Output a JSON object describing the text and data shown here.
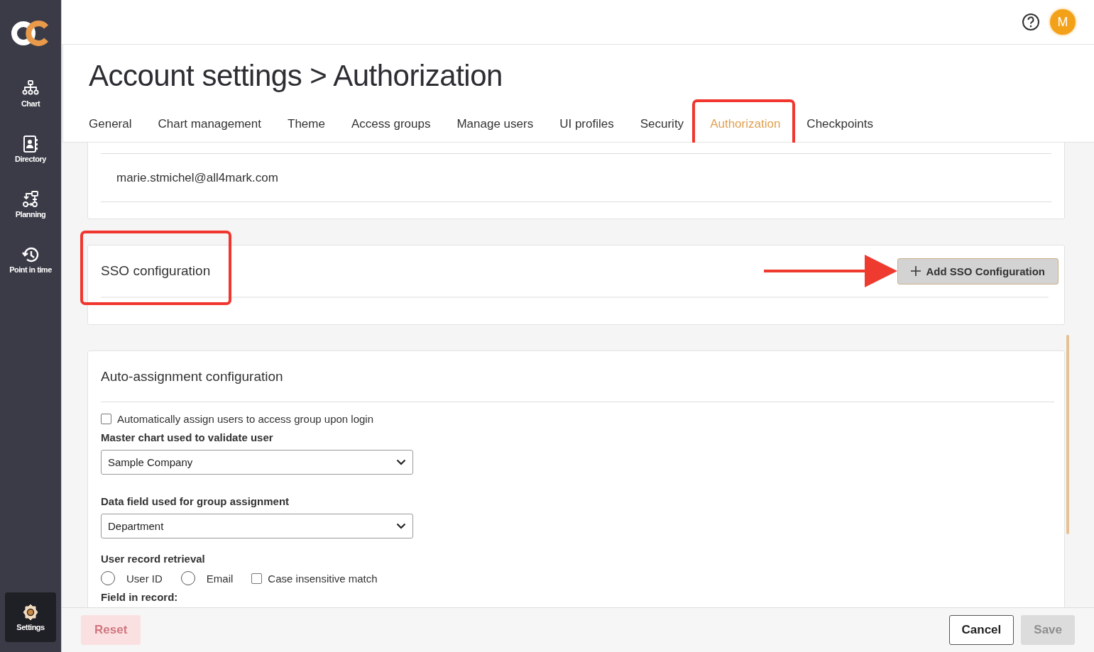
{
  "sidebar": {
    "items": [
      {
        "kind": "chart",
        "label": "Chart",
        "selected": false
      },
      {
        "kind": "directory",
        "label": "Directory",
        "selected": false
      },
      {
        "kind": "planning",
        "label": "Planning",
        "selected": false
      },
      {
        "kind": "history",
        "label": "Point in time",
        "selected": false
      }
    ],
    "bottom_item": {
      "kind": "settings",
      "label": "Settings",
      "selected": true
    }
  },
  "topbar": {
    "avatar": "M"
  },
  "page_title": "Account settings > Authorization",
  "tabs": [
    {
      "label": "General",
      "selected": false,
      "highlighted": false
    },
    {
      "label": "Chart management",
      "selected": false,
      "highlighted": false
    },
    {
      "label": "Theme",
      "selected": false,
      "highlighted": false
    },
    {
      "label": "Access groups",
      "selected": false,
      "highlighted": false
    },
    {
      "label": "Manage users",
      "selected": false,
      "highlighted": false
    },
    {
      "label": "UI profiles",
      "selected": false,
      "highlighted": false
    },
    {
      "label": "Security",
      "selected": false,
      "highlighted": false
    },
    {
      "label": "Authorization",
      "selected": true,
      "highlighted": true
    },
    {
      "label": "Checkpoints",
      "selected": false,
      "highlighted": false
    }
  ],
  "sections": [
    {
      "kind": "user_list",
      "rows": [
        "marie.stmichel@all4mark.com"
      ]
    },
    {
      "kind": "sso",
      "title": "SSO configuration",
      "highlighted": true,
      "button": {
        "label": "Add SSO Configuration",
        "pointed": true
      }
    },
    {
      "kind": "form",
      "title": "Auto-assignment configuration",
      "fields": [
        {
          "kind": "checkbox",
          "label": "Automatically assign users to access group upon login",
          "checked": false
        },
        {
          "kind": "select",
          "label": "Master chart used to validate user",
          "value": "Sample Company"
        },
        {
          "kind": "select",
          "label": "Data field used for group assignment",
          "value": "Department"
        },
        {
          "kind": "choices",
          "label": "User record retrieval",
          "options": [
            {
              "kind": "radio",
              "label": "User ID",
              "selected": false
            },
            {
              "kind": "radio",
              "label": "Email",
              "selected": false
            },
            {
              "kind": "checkbox",
              "label": "Case insensitive match",
              "checked": false
            }
          ]
        },
        {
          "kind": "heading",
          "label": "Field in record:"
        }
      ]
    }
  ],
  "footer": {
    "buttons": [
      {
        "kind": "danger",
        "label": "Reset",
        "disabled": true
      },
      {
        "kind": "secondary",
        "label": "Cancel",
        "disabled": false
      },
      {
        "kind": "primary",
        "label": "Save",
        "disabled": true
      }
    ]
  }
}
